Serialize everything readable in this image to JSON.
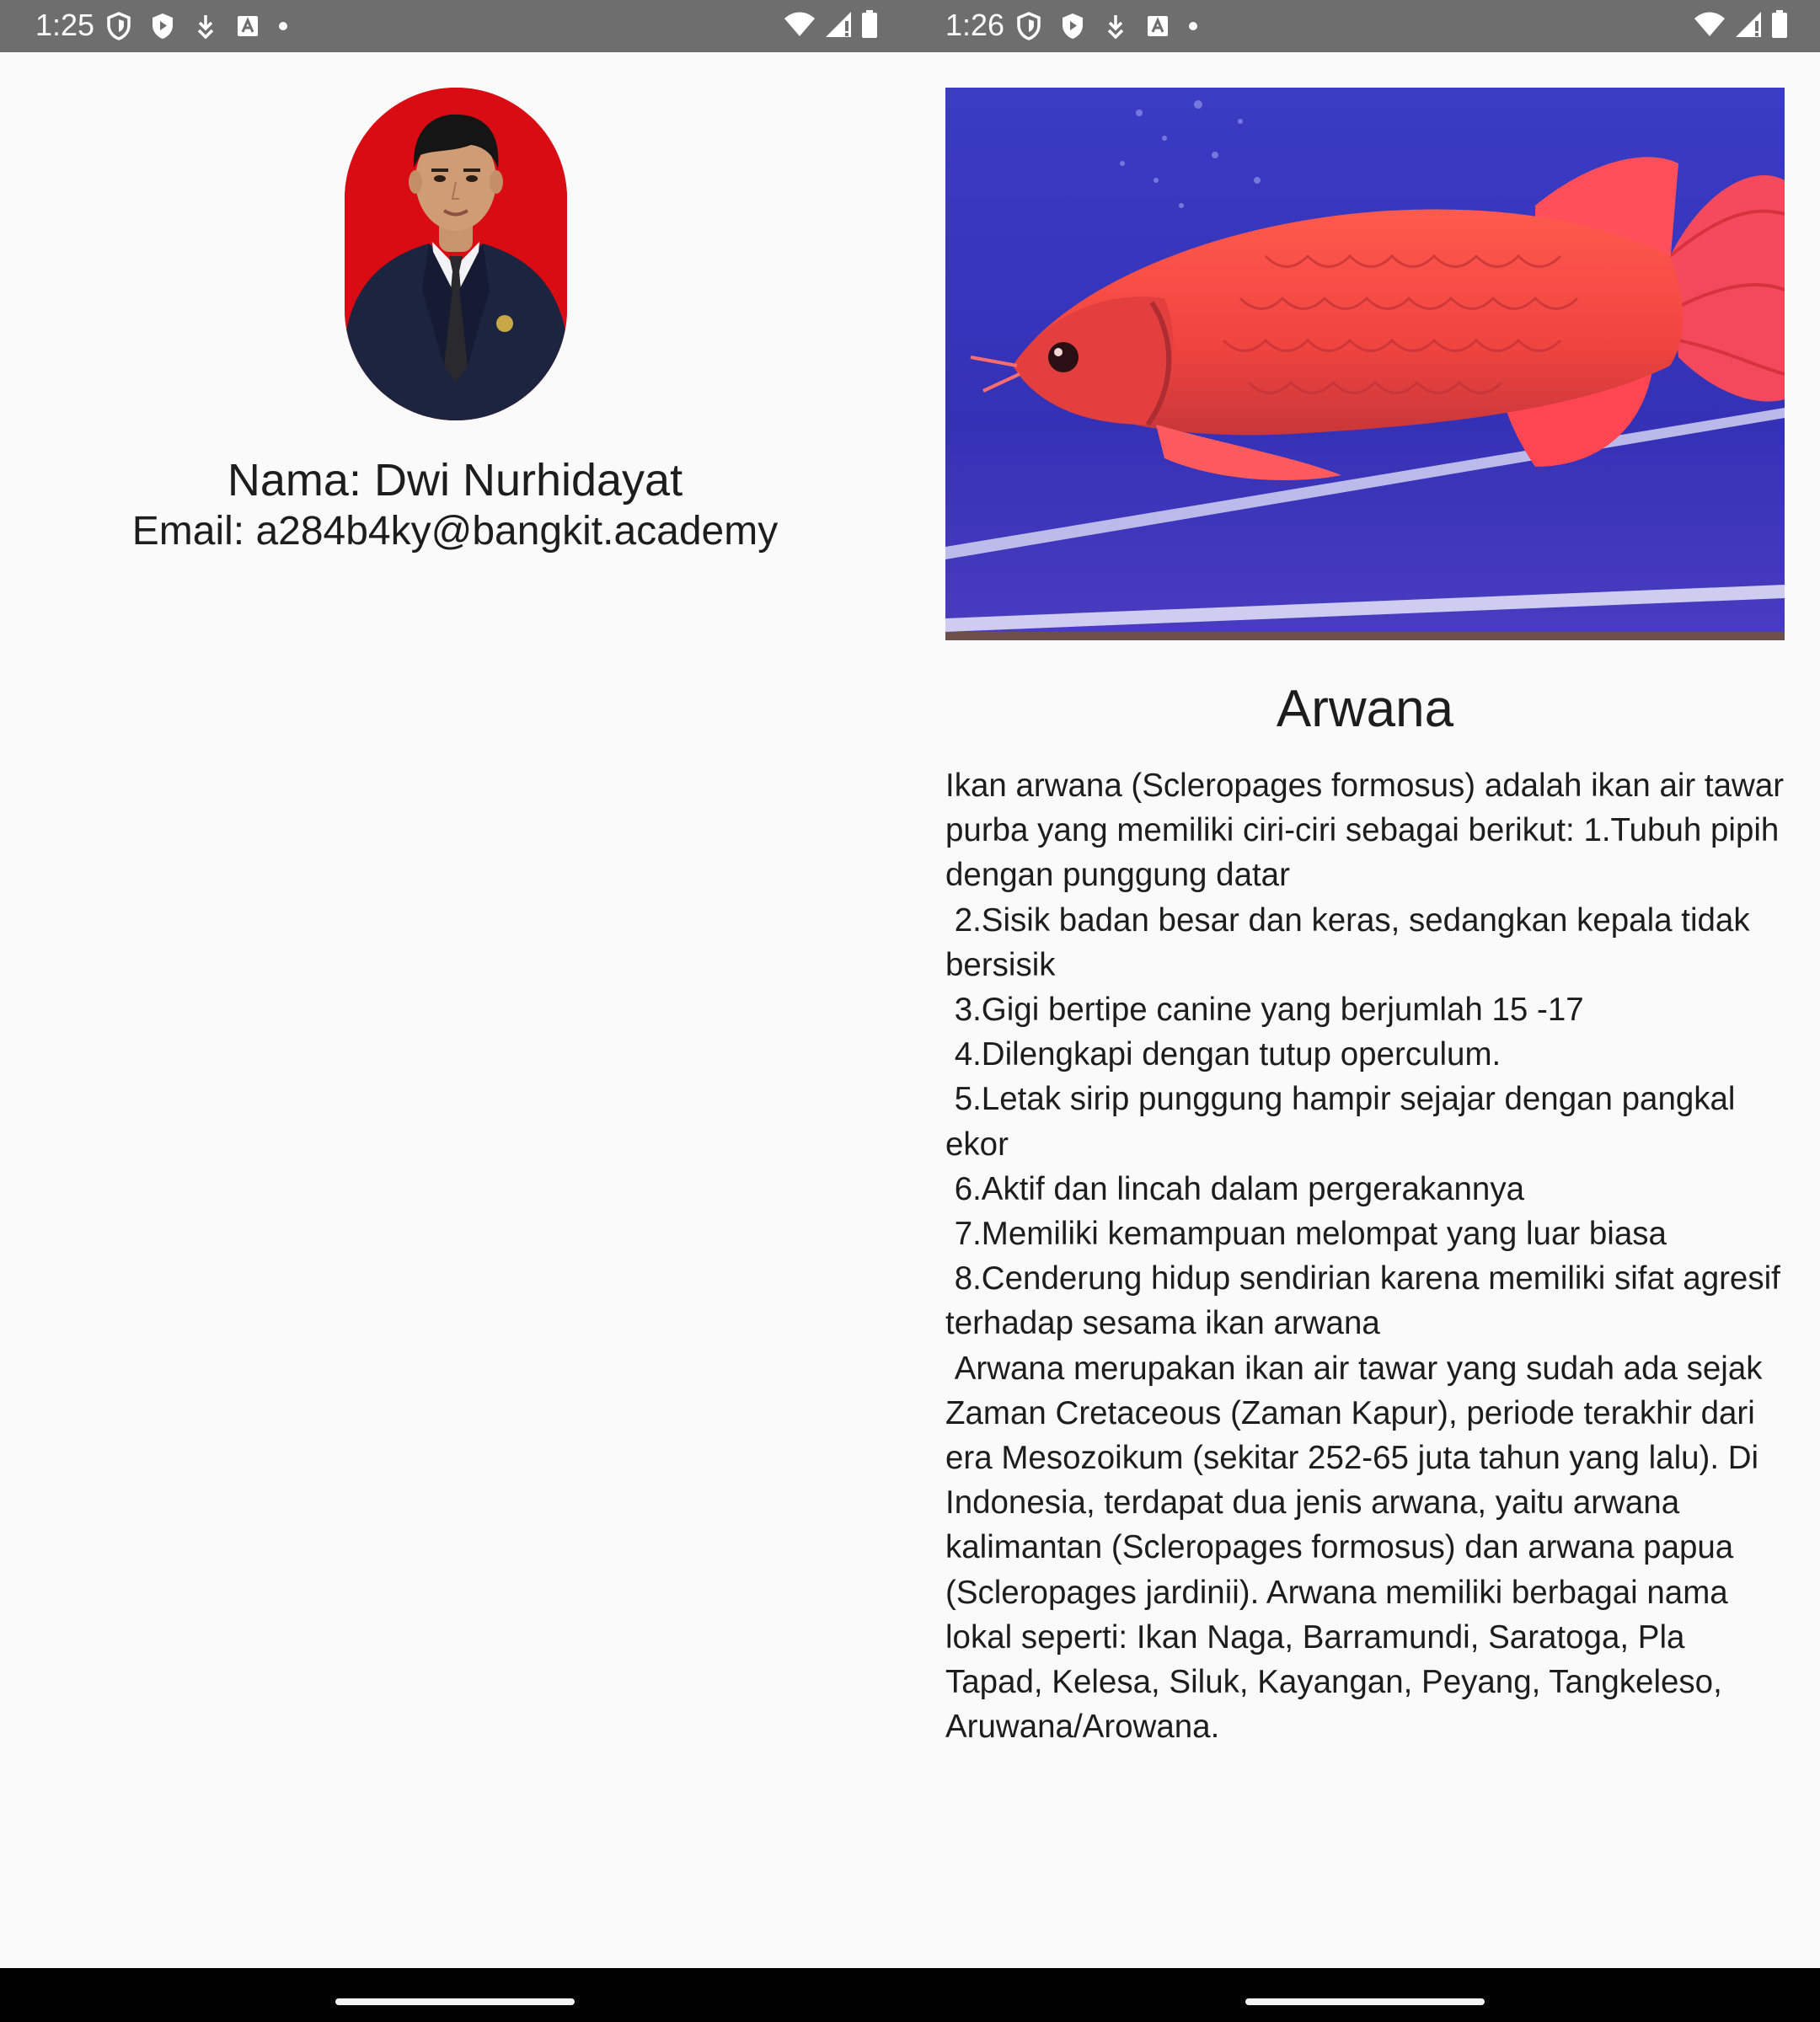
{
  "left_screen": {
    "status_bar": {
      "time": "1:25"
    },
    "profile": {
      "name": "Nama: Dwi Nurhidayat",
      "email": "Email: a284b4ky@bangkit.academy"
    }
  },
  "right_screen": {
    "status_bar": {
      "time": "1:26"
    },
    "detail": {
      "title": "Arwana",
      "description": "Ikan arwana (Scleropages formosus) adalah ikan air tawar purba yang memiliki ciri-ciri sebagai berikut: 1.Tubuh pipih dengan punggung datar\n 2.Sisik badan besar dan keras, sedangkan kepala tidak bersisik\n 3.Gigi bertipe canine yang berjumlah 15 -17\n 4.Dilengkapi dengan tutup operculum.\n 5.Letak sirip punggung hampir sejajar dengan pangkal ekor\n 6.Aktif dan lincah dalam pergerakannya\n 7.Memiliki kemampuan melompat yang luar biasa\n 8.Cenderung hidup sendirian karena memiliki sifat agresif terhadap sesama ikan arwana\n Arwana merupakan ikan air tawar yang sudah ada sejak Zaman Cretaceous (Zaman Kapur), periode terakhir dari era Mesozoikum (sekitar 252-65 juta tahun yang lalu). Di Indonesia, terdapat dua jenis arwana, yaitu arwana kalimantan (Scleropages formosus) dan arwana papua (Scleropages jardinii). Arwana memiliki berbagai nama lokal seperti: Ikan Naga, Barramundi, Saratoga, Pla Tapad, Kelesa, Siluk, Kayangan, Peyang, Tangkeleso, Aruwana/Arowana."
    }
  },
  "colors": {
    "status_bar_bg": "#6e6e6e",
    "nav_bar_bg": "#000000",
    "app_bg": "#fafafa",
    "avatar_bg": "#d90b13",
    "fish_red": "#f0443f",
    "water_blue": "#3532b8"
  },
  "icons": [
    "shield-icon",
    "play-protect-icon",
    "download-icon",
    "font-a-icon",
    "dot-icon",
    "wifi-icon",
    "signal-icon",
    "battery-icon"
  ]
}
